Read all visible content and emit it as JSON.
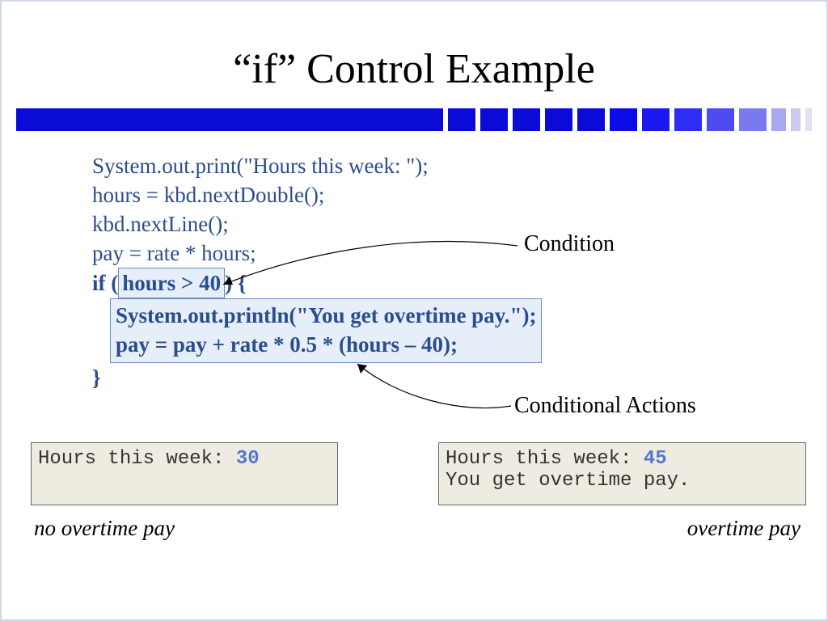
{
  "title": "“if” Control Example",
  "code": {
    "line1": "System.out.print(\"Hours this week: \");",
    "line2": "hours = kbd.nextDouble();",
    "line3": "kbd.nextLine();",
    "line4": "pay = rate * hours;",
    "if_kw": "if (",
    "condition": "hours > 40",
    "if_brace": ") {",
    "body1": "System.out.println(\"You get overtime pay.\");",
    "body2": " pay = pay + rate * 0.5 * (hours – 40);",
    "close": "}"
  },
  "labels": {
    "condition": "Condition",
    "conditional_actions": "Conditional Actions"
  },
  "output_left": {
    "prompt": "Hours this week: ",
    "value": "30"
  },
  "output_right": {
    "prompt": "Hours this week: ",
    "value": "45",
    "line2": "You get overtime pay."
  },
  "captions": {
    "left": "no overtime pay",
    "right": "overtime pay"
  },
  "stripe_colors": [
    "#0b0bd8",
    "#0b0bd8",
    "#0b0bd8",
    "#0b0bd8",
    "#0b0bd8",
    "#0b0bea",
    "#1a1af0",
    "#2d2df4",
    "#4c4cf0",
    "#7a7af0",
    "#a8a8f0",
    "#cacaf0",
    "#e0e0f5"
  ]
}
